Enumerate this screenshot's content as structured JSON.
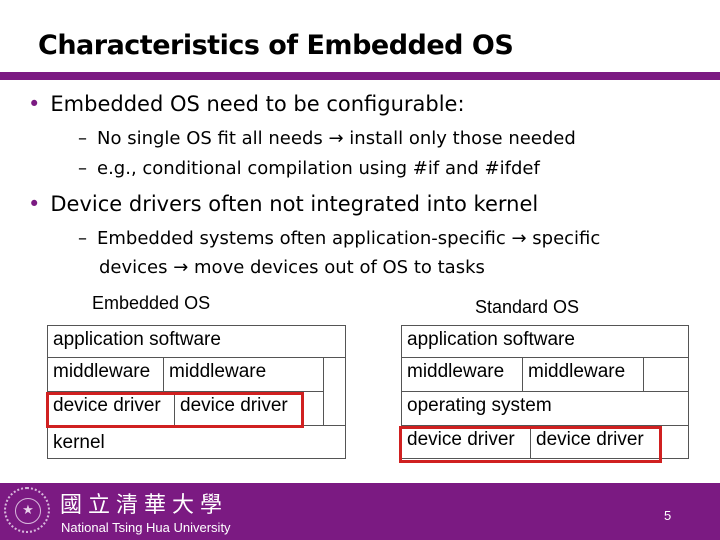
{
  "title": "Characteristics of Embedded OS",
  "bullets": [
    {
      "text": "Embedded OS need to be configurable:",
      "subs": [
        "No single OS fit all needs → install only those needed",
        "e.g., conditional compilation using #if and #ifdef"
      ]
    },
    {
      "text": "Device drivers often not integrated into kernel",
      "subs": [
        "Embedded systems often application-specific → specific",
        "devices → move devices out of OS to tasks"
      ]
    }
  ],
  "left_diagram": {
    "label": "Embedded OS",
    "app": "application software",
    "mw1": "middleware",
    "mw2": "middleware",
    "dd1": "device driver",
    "dd2": "device driver",
    "kernel": "kernel"
  },
  "right_diagram": {
    "label": "Standard OS",
    "app": "application software",
    "mw1": "middleware",
    "mw2": "middleware",
    "os": "operating system",
    "dd1": "device driver",
    "dd2": "device driver"
  },
  "footer": {
    "logo_cn": "國立清華大學",
    "university": "National Tsing Hua University",
    "page": "5"
  },
  "colors": {
    "accent": "#7b1a82",
    "highlight": "#d02020"
  }
}
